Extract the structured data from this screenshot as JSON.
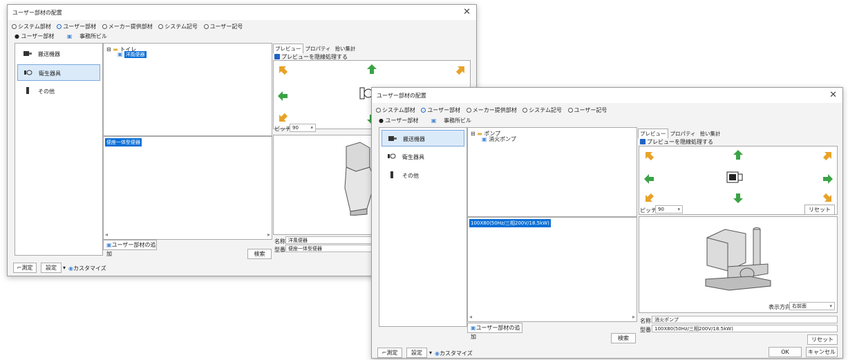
{
  "back": {
    "title": "ユーザー部材の配置",
    "radios": [
      {
        "label": "システム部材",
        "selected": false
      },
      {
        "label": "ユーザー部材",
        "selected": true
      },
      {
        "label": "メーカー提供部材",
        "selected": false
      },
      {
        "label": "システム記号",
        "selected": false
      },
      {
        "label": "ユーザー記号",
        "selected": false
      }
    ],
    "subtabs": [
      "ユーザー部材",
      "事務所ビル"
    ],
    "categories": [
      "搬送機器",
      "衛生器具",
      "その他"
    ],
    "tree_root": "トイレ",
    "tree_child": "洋風便器",
    "list_item": "便座一体型便器",
    "preview_tabs": [
      "プレビュー",
      "プロパティ",
      "拾い集計"
    ],
    "preview_check": "プレビューを隠線処理する",
    "pitch_label": "ピッチ",
    "pitch_value": "90",
    "add_button": "ユーザー部材の追加",
    "search_button": "検索",
    "name_label": "名称",
    "name_value": "洋風便器",
    "model_label": "型番",
    "model_value": "便座一体型便器",
    "footer": {
      "measure": "測定",
      "settings": "設定",
      "customize": "カスタマイズ"
    }
  },
  "front": {
    "title": "ユーザー部材の配置",
    "radios": [
      {
        "label": "システム部材",
        "selected": false
      },
      {
        "label": "ユーザー部材",
        "selected": true
      },
      {
        "label": "メーカー提供部材",
        "selected": false
      },
      {
        "label": "システム記号",
        "selected": false
      },
      {
        "label": "ユーザー記号",
        "selected": false
      }
    ],
    "subtabs": [
      "ユーザー部材",
      "事務所ビル"
    ],
    "categories": [
      "搬送機器",
      "衛生器具",
      "その他"
    ],
    "tree_root": "ポンプ",
    "tree_child": "消火ポンプ",
    "list_item": "100X80(50Hz/三相200V/18.5kW)",
    "preview_tabs": [
      "プレビュー",
      "プロパティ",
      "拾い集計"
    ],
    "preview_check": "プレビューを隠線処理する",
    "pitch_label": "ピッチ",
    "pitch_value": "90",
    "reset_label": "リセット",
    "view_dir_label": "表示方向",
    "view_dir_value": "右前面",
    "add_button": "ユーザー部材の追加",
    "search_button": "検索",
    "name_label": "名称",
    "name_value": "消火ポンプ",
    "model_label": "型番",
    "model_value": "100X80(50Hz/三相200V/18.5kW)",
    "reset2_label": "リセット",
    "footer": {
      "measure": "測定",
      "settings": "設定",
      "customize": "カスタマイズ",
      "ok": "OK",
      "cancel": "キャンセル"
    }
  },
  "colors": {
    "accent": "#0a6fd6",
    "selection_bg": "#dbeaf9",
    "arrow_green": "#3aa346",
    "arrow_orange": "#e8a227"
  }
}
